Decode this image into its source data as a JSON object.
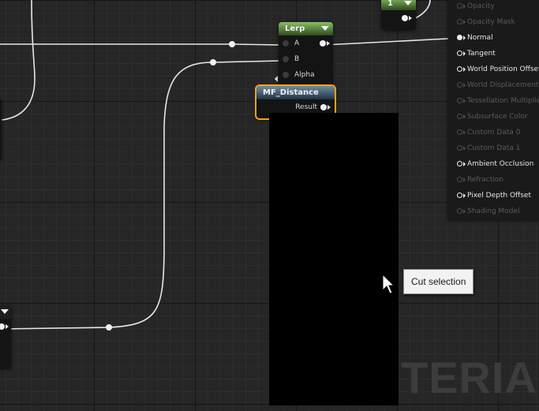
{
  "graph": {
    "lerp_node": {
      "title": "Lerp",
      "inputs": [
        {
          "label": "A"
        },
        {
          "label": "B"
        },
        {
          "label": "Alpha"
        }
      ]
    },
    "function_node": {
      "title": "MF_Distance",
      "output_label": "Result"
    },
    "constant_node": {
      "value": "1"
    }
  },
  "result_panel": {
    "pins": [
      {
        "label": "Opacity",
        "enabled": false
      },
      {
        "label": "Opacity Mask",
        "enabled": false
      },
      {
        "label": "Normal",
        "enabled": true,
        "connected": true
      },
      {
        "label": "Tangent",
        "enabled": true
      },
      {
        "label": "World Position Offset",
        "enabled": true
      },
      {
        "label": "World Displacement",
        "enabled": false
      },
      {
        "label": "Tessellation Multiplier",
        "enabled": false
      },
      {
        "label": "Subsurface Color",
        "enabled": false
      },
      {
        "label": "Custom Data 0",
        "enabled": false
      },
      {
        "label": "Custom Data 1",
        "enabled": false
      },
      {
        "label": "Ambient Occlusion",
        "enabled": true
      },
      {
        "label": "Refraction",
        "enabled": false
      },
      {
        "label": "Pixel Depth Offset",
        "enabled": true
      },
      {
        "label": "Shading Model",
        "enabled": false
      }
    ]
  },
  "watermark": {
    "text": "TERIAL"
  },
  "tooltip": {
    "text": "Cut selection"
  },
  "cursor": {
    "icon": "arrow-cursor-icon"
  },
  "colors": {
    "selection_outline": "#f2a11a",
    "lerp_header": "#8bbf64",
    "function_header": "#6f8da3",
    "graph_background": "#262626"
  }
}
